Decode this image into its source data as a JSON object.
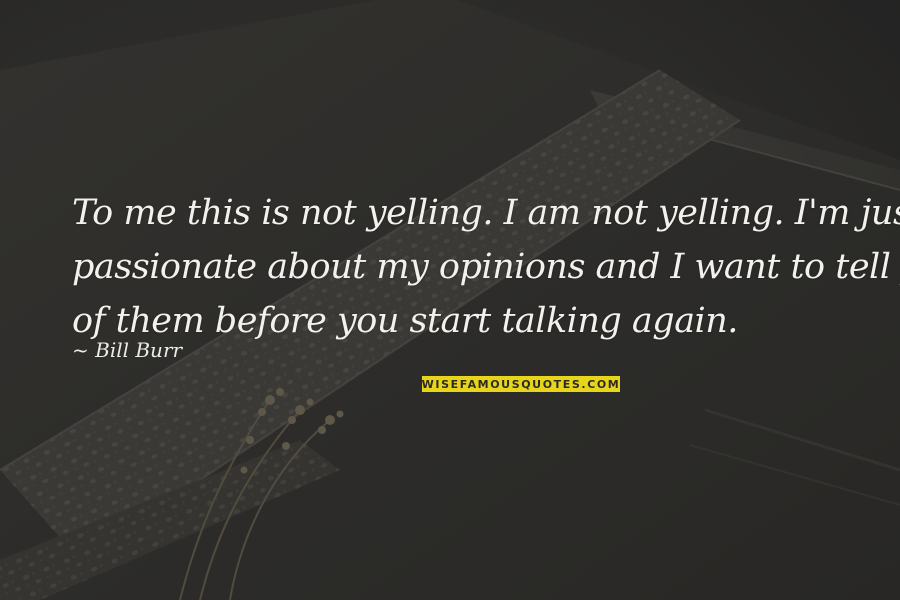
{
  "quote": {
    "lines": [
      "To me this is not yelling. I am not yelling. I'm just",
      "passionate about my opinions and I want to tell you all",
      "of them before you start talking again."
    ]
  },
  "author": {
    "text": "~ Bill Burr"
  },
  "watermark": {
    "text": "WISEFAMOUSQUOTES.COM",
    "background_color": "#e7d51c"
  },
  "background": {
    "scene": "book-with-lace-ribbon-and-dried-flowers"
  }
}
